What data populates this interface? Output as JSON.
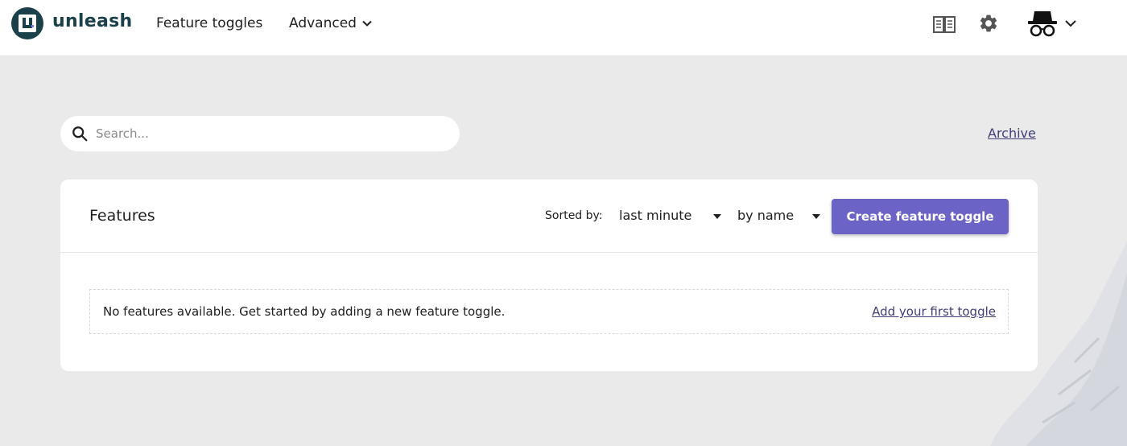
{
  "app": {
    "brand": "unleash",
    "logo_icon": "unleash-logo-icon"
  },
  "nav": {
    "feature_toggles": "Feature toggles",
    "advanced": "Advanced"
  },
  "top_icons": [
    "docs-book-icon",
    "settings-gear-icon",
    "incognito-avatar-icon",
    "chevron-down-icon"
  ],
  "search": {
    "placeholder": "Search...",
    "value": ""
  },
  "archive_label": "Archive",
  "features": {
    "title": "Features",
    "sorted_by_label": "Sorted by:",
    "sort_value": "last minute",
    "group_value": "by name",
    "create_button": "Create feature toggle",
    "empty_message": "No features available. Get started by adding a new feature toggle.",
    "add_first_link": "Add your first toggle"
  },
  "colors": {
    "primary": "#6c63c7",
    "link": "#3f3e77",
    "brand": "#1a4049",
    "page_bg": "#eaeaea"
  }
}
